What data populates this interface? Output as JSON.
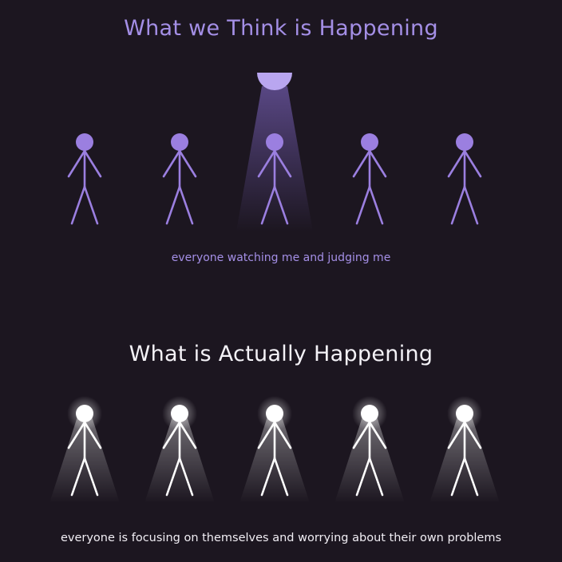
{
  "colors": {
    "background": "#1c1620",
    "purple": "#9b7fe0",
    "purple_text": "#a48fe6",
    "white": "#ffffff"
  },
  "top_panel": {
    "title": "What we Think is Happening",
    "caption": "everyone watching me and judging me",
    "figures": 5,
    "icons": [
      "spotlight-lamp-icon",
      "stick-figure-icon"
    ]
  },
  "bottom_panel": {
    "title": "What is Actually Happening",
    "caption": "everyone is focusing on themselves and worrying about their own problems",
    "figures": 5,
    "icons": [
      "glowing-head-stick-figure-icon"
    ]
  }
}
